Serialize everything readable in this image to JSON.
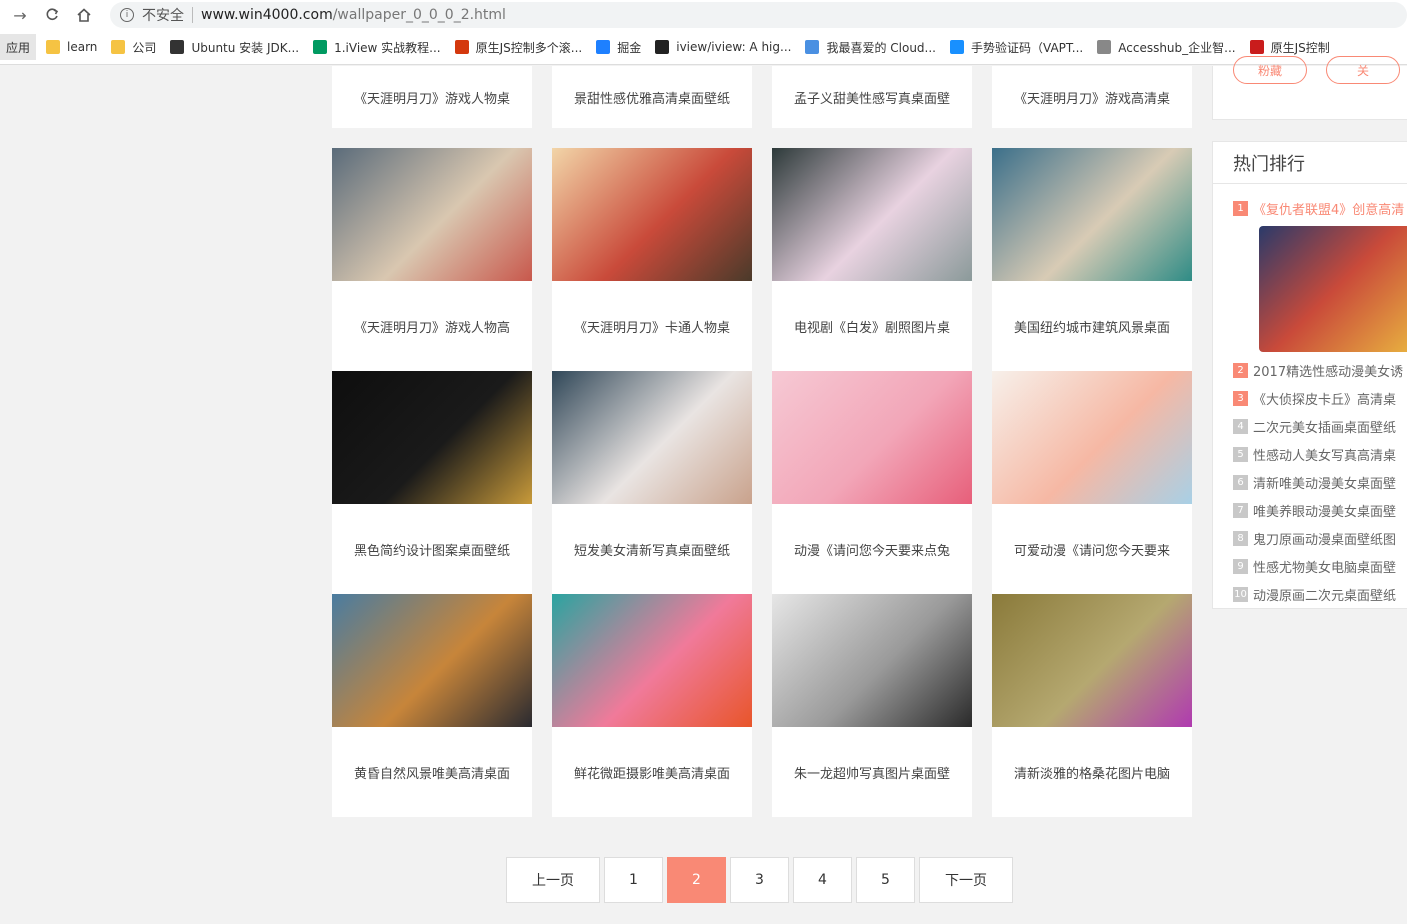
{
  "browser": {
    "security_text": "不安全",
    "url_host": "www.win4000.com",
    "url_path": "/wallpaper_0_0_0_2.html"
  },
  "bookmarks": {
    "apps_label": "应用",
    "items": [
      {
        "label": "learn",
        "icon": "folder-icon",
        "color": "#f5c343"
      },
      {
        "label": "公司",
        "icon": "folder-icon",
        "color": "#f5c343"
      },
      {
        "label": "Ubuntu 安装 JDK...",
        "icon": "linux-icon",
        "color": "#333333"
      },
      {
        "label": "1.iView 实战教程...",
        "icon": "segmentfault-icon",
        "color": "#009a61"
      },
      {
        "label": "原生JS控制多个滚...",
        "icon": "b-logo-icon",
        "color": "#d4380d"
      },
      {
        "label": "掘金",
        "icon": "juejin-icon",
        "color": "#1e80ff"
      },
      {
        "label": "iview/iview: A hig...",
        "icon": "github-icon",
        "color": "#222222"
      },
      {
        "label": "我最喜爱的 Cloud...",
        "icon": "cloud-icon",
        "color": "#4a90e2"
      },
      {
        "label": "手势验证码（VAPT...",
        "icon": "shield-icon",
        "color": "#1890ff"
      },
      {
        "label": "Accesshub_企业智...",
        "icon": "share-icon",
        "color": "#888888"
      },
      {
        "label": "原生JS控制",
        "icon": "csdn-icon",
        "color": "#c91c1c"
      }
    ]
  },
  "top_captions": [
    "《天涯明月刀》游戏人物桌",
    "景甜性感优雅高清桌面壁纸",
    "孟子义甜美性感写真桌面壁",
    "《天涯明月刀》游戏高清桌"
  ],
  "grid": [
    {
      "caption": "《天涯明月刀》游戏人物高",
      "colors": [
        "#5a6b7a",
        "#d9c7b0",
        "#c8584c"
      ]
    },
    {
      "caption": "《天涯明月刀》卡通人物桌",
      "colors": [
        "#f2d5a8",
        "#c94a3a",
        "#4a3a2a"
      ]
    },
    {
      "caption": "电视剧《白发》剧照图片桌",
      "colors": [
        "#2d3a3a",
        "#e8d2e0",
        "#8b9a9a"
      ]
    },
    {
      "caption": "美国纽约城市建筑风景桌面",
      "colors": [
        "#3b6f8a",
        "#d8cbb5",
        "#2f8c86"
      ]
    },
    {
      "caption": "黑色简约设计图案桌面壁纸",
      "colors": [
        "#0e0e0e",
        "#1a1a1a",
        "#c89a3a"
      ]
    },
    {
      "caption": "短发美女清新写真桌面壁纸",
      "colors": [
        "#304758",
        "#e9e4e2",
        "#c9a28c"
      ]
    },
    {
      "caption": "动漫《请问您今天要来点兔",
      "colors": [
        "#f6c9d4",
        "#f2a6b8",
        "#e75f7a"
      ]
    },
    {
      "caption": "可爱动漫《请问您今天要来",
      "colors": [
        "#f7f0ea",
        "#f6b8a4",
        "#a8d0e6"
      ]
    },
    {
      "caption": "黄昏自然风景唯美高清桌面",
      "colors": [
        "#4a7ca0",
        "#c7853a",
        "#2a2a30"
      ]
    },
    {
      "caption": "鲜花微距摄影唯美高清桌面",
      "colors": [
        "#2aa4a0",
        "#f07a9a",
        "#e8552a"
      ]
    },
    {
      "caption": "朱一龙超帅写真图片桌面壁",
      "colors": [
        "#e6e6e6",
        "#9a9a9a",
        "#2a2a2a"
      ]
    },
    {
      "caption": "清新淡雅的格桑花图片电脑",
      "colors": [
        "#8a7a3a",
        "#b5a870",
        "#b03ab0"
      ]
    }
  ],
  "sidebar": {
    "title": "热门排行",
    "items": [
      {
        "num": "1",
        "text": "《复仇者联盟4》创意高清"
      },
      {
        "num": "2",
        "text": "2017精选性感动漫美女诱"
      },
      {
        "num": "3",
        "text": "《大侦探皮卡丘》高清桌"
      },
      {
        "num": "4",
        "text": "二次元美女插画桌面壁纸"
      },
      {
        "num": "5",
        "text": "性感动人美女写真高清桌"
      },
      {
        "num": "6",
        "text": "清新唯美动漫美女桌面壁"
      },
      {
        "num": "7",
        "text": "唯美养眼动漫美女桌面壁"
      },
      {
        "num": "8",
        "text": "鬼刀原画动漫桌面壁纸图"
      },
      {
        "num": "9",
        "text": "性感尤物美女电脑桌面壁"
      },
      {
        "num": "10",
        "text": "动漫原画二次元桌面壁纸"
      }
    ],
    "top_buttons": [
      "粉藏",
      "关"
    ]
  },
  "pagination": {
    "prev": "上一页",
    "pages": [
      "1",
      "2",
      "3",
      "4",
      "5"
    ],
    "current": "2",
    "next": "下一页"
  },
  "colors": {
    "accent": "#f98975",
    "rank_grey": "#c8c8c8"
  }
}
